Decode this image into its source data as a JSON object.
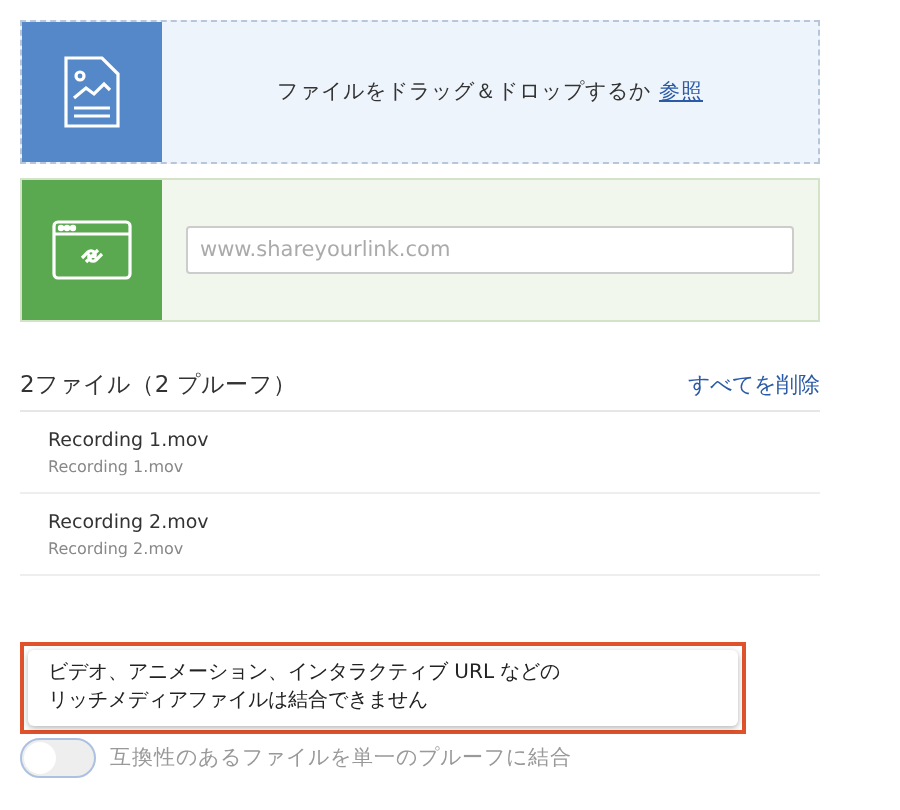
{
  "drop_zone": {
    "text": "ファイルをドラッグ＆ドロップするか",
    "link": "参照"
  },
  "link_zone": {
    "placeholder": "www.shareyourlink.com"
  },
  "files": {
    "heading": "2ファイル（2 プルーフ）",
    "remove_all": "すべてを削除",
    "items": [
      {
        "name": "Recording 1.mov",
        "subtitle": "Recording 1.mov"
      },
      {
        "name": "Recording 2.mov",
        "subtitle": "Recording 2.mov"
      }
    ]
  },
  "tooltip": {
    "lines": [
      "ビデオ、アニメーション、インタラクティブ URL などの",
      "リッチメディアファイルは結合できません"
    ]
  },
  "combine_toggle": {
    "label": "互換性のあるファイルを単一のプルーフに結合",
    "on": false,
    "disabled": true
  }
}
